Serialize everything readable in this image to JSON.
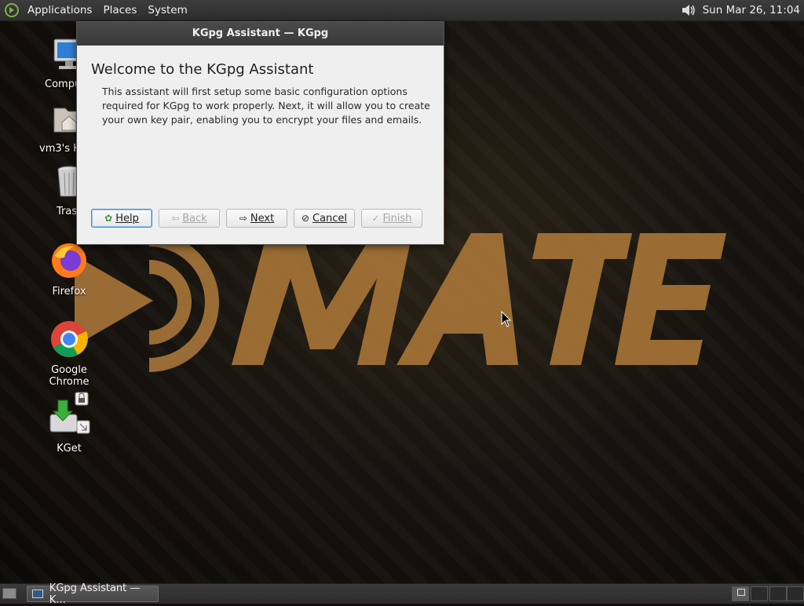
{
  "top_panel": {
    "menus": [
      "Applications",
      "Places",
      "System"
    ],
    "clock": "Sun Mar 26, 11:04"
  },
  "desktop_icons": [
    {
      "label": "Compu",
      "icon": "computer-icon"
    },
    {
      "label": "vm3's H",
      "icon": "home-folder-icon"
    },
    {
      "label": "Tras",
      "icon": "trash-icon"
    },
    {
      "label": "Firefox",
      "icon": "firefox-icon"
    },
    {
      "label": "Google Chrome",
      "icon": "chrome-icon"
    },
    {
      "label": "KGet",
      "icon": "kget-icon"
    }
  ],
  "dialog": {
    "title": "KGpg Assistant — KGpg",
    "heading": "Welcome to the KGpg Assistant",
    "text": "This assistant will first setup some basic configuration options required for KGpg to work properly. Next, it will allow you to create your own key pair, enabling you to encrypt your files and emails.",
    "buttons": {
      "help": "Help",
      "back": "Back",
      "next": "Next",
      "cancel": "Cancel",
      "finish": "Finish"
    }
  },
  "taskbar": {
    "task_label": "KGpg Assistant — K..."
  },
  "colors": {
    "wallpaper_logo": "#a9773a",
    "panel": "#333333",
    "dialog_bg": "#efefef",
    "default_button_border": "#3f8ac7"
  }
}
